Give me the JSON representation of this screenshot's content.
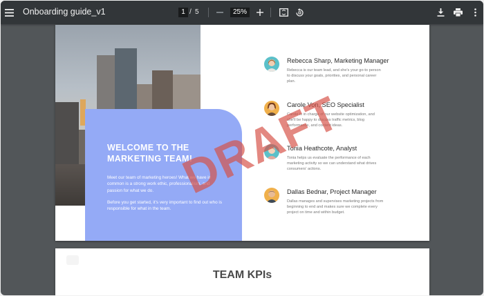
{
  "toolbar": {
    "title": "Onboarding guide_v1",
    "current_page": "1",
    "page_separator": "/",
    "total_pages": "5",
    "zoom": "25%",
    "icons": [
      "menu-icon",
      "zoom-out-icon",
      "zoom-in-icon",
      "fit-page-icon",
      "rotate-icon",
      "download-icon",
      "print-icon",
      "more-icon"
    ]
  },
  "page1": {
    "welcome_title": "WELCOME TO THE MARKETING TEAM!",
    "welcome_para1": "Meet our team of marketing heroes! What we have in common is a strong work ethic, professionalism, and passion for what we do.",
    "welcome_para2": "Before you get started, it's very important to find out who is responsible for what in the team.",
    "watermark": "DRAFT",
    "members": [
      {
        "name": "Rebecca Sharp, Marketing Manager",
        "desc": "Rebecca is our team lead, and she's your go-to person to discuss your goals, priorities, and personal career plan."
      },
      {
        "name": "Carole Von, SEO Specialist",
        "desc": "Carole is in charge of our website optimization, and she'll be happy to discuss traffic metrics, blog performance, and content ideas."
      },
      {
        "name": "Tonia Heathcote, Analyst",
        "desc": "Tonia helps us evaluate the performance of each marketing activity so we can understand what drives consumers' actions."
      },
      {
        "name": "Dallas Bednar, Project Manager",
        "desc": "Dallas manages and supervises marketing projects from beginning to end and makes sure we complete every project on time and within budget."
      }
    ],
    "avatar_colors": [
      "#5bc0c9",
      "#f0b04b",
      "#5bc0c9",
      "#f0b04b"
    ]
  },
  "page2": {
    "title": "TEAM KPIs"
  },
  "colors": {
    "viewer_bg": "#525659",
    "toolbar_bg": "#323639",
    "welcome_card": "#94aaf6",
    "watermark": "#d65046"
  }
}
